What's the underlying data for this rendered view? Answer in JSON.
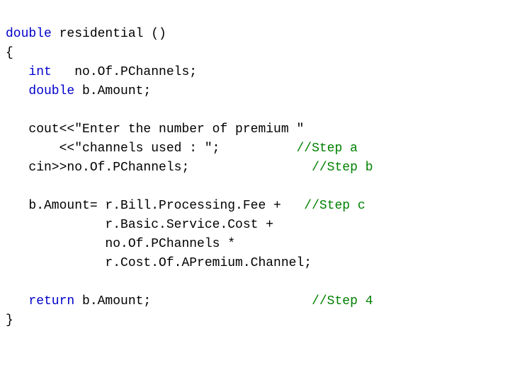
{
  "code": {
    "line1_kw": "double",
    "line1_rest": " residential ()",
    "line2": "{",
    "line3_indent": "   ",
    "line3_kw": "int",
    "line3_rest": "   no.Of.PChannels;",
    "line4_indent": "   ",
    "line4_kw": "double",
    "line4_rest": " b.Amount;",
    "blank1": "",
    "line6_text": "   cout<<\"Enter the number of premium \"",
    "line7_text": "       <<\"channels used : \";          ",
    "line7_cm": "//Step a",
    "line8_text": "   cin>>no.Of.PChannels;                ",
    "line8_cm": "//Step b",
    "blank2": "",
    "line10_text": "   b.Amount= r.Bill.Processing.Fee +   ",
    "line10_cm": "//Step c",
    "line11_text": "             r.Basic.Service.Cost +",
    "line12_text": "             no.Of.PChannels *",
    "line13_text": "             r.Cost.Of.APremium.Channel;",
    "blank3": "",
    "line15_indent": "   ",
    "line15_kw": "return",
    "line15_rest": " b.Amount;                     ",
    "line15_cm": "//Step 4",
    "line16": "}"
  }
}
